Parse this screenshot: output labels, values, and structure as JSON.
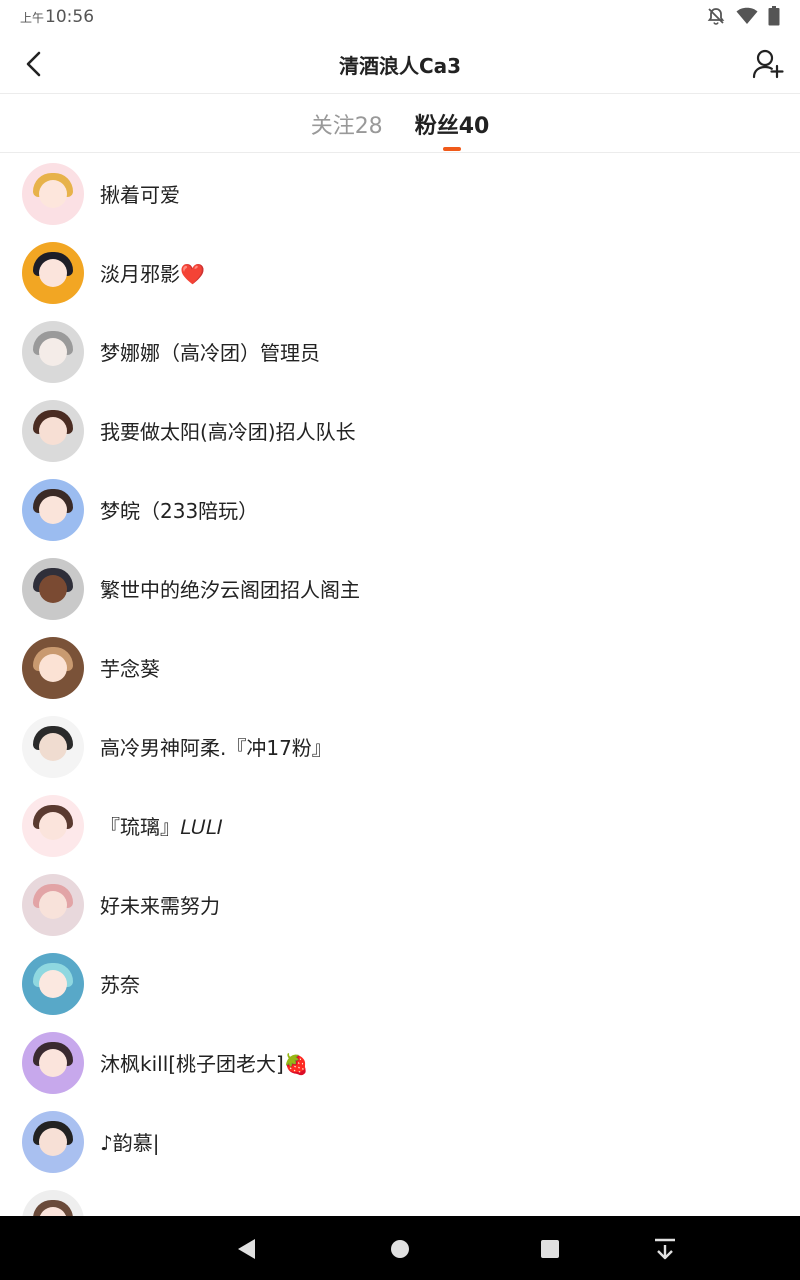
{
  "status_bar": {
    "ampm": "上午",
    "time": "10:56",
    "icons": [
      "bell-off-icon",
      "wifi-icon",
      "battery-icon"
    ]
  },
  "header": {
    "title": "清酒浪人Ca3",
    "back_icon": "back-arrow-icon",
    "add_user_icon": "add-user-icon"
  },
  "tabs": [
    {
      "label": "关注28",
      "active": false
    },
    {
      "label": "粉丝40",
      "active": true
    }
  ],
  "accent_color": "#f05a1a",
  "followers": [
    {
      "name": "揪着可爱",
      "avatar_bg": "#fbe0e4",
      "hair": "#e7b24a",
      "face": "#fde6dc"
    },
    {
      "name": "淡月邪影❤️",
      "avatar_bg": "#f2a623",
      "hair": "#1e1e28",
      "face": "#fbe4dc"
    },
    {
      "name": "梦娜娜（高冷团）管理员",
      "avatar_bg": "#d9d9d9",
      "hair": "#9a9a9a",
      "face": "#f4ece8"
    },
    {
      "name": "我要做太阳(高冷团)招人队长",
      "avatar_bg": "#dadada",
      "hair": "#4a2c22",
      "face": "#f7dfd4"
    },
    {
      "name": "梦皖（233陪玩）",
      "avatar_bg": "#9bbcf0",
      "hair": "#3a2a26",
      "face": "#fae4da"
    },
    {
      "name": "繁世中的绝汐云阁团招人阁主",
      "avatar_bg": "#c9c9c9",
      "hair": "#2f2f3a",
      "face": "#7a4a32"
    },
    {
      "name": "芋念葵",
      "avatar_bg": "#7a5238",
      "hair": "#c99a70",
      "face": "#fbe2d4"
    },
    {
      "name": "高冷男神阿柔.『冲17粉』",
      "avatar_bg": "#f4f4f4",
      "hair": "#2a2a2a",
      "face": "#f0dcd0"
    },
    {
      "name": "『琉璃』𝐿𝑈𝐿𝐼",
      "avatar_bg": "#fde8ea",
      "hair": "#5a3a30",
      "face": "#fbe4dc"
    },
    {
      "name": "好未来需努力",
      "avatar_bg": "#e8d8dc",
      "hair": "#e2a4a6",
      "face": "#f8e2da"
    },
    {
      "name": "苏奈",
      "avatar_bg": "#58a8c8",
      "hair": "#8fd8e0",
      "face": "#fbe8e0"
    },
    {
      "name": "沐枫kill[桃子团老大]🍓",
      "avatar_bg": "#c7a8ec",
      "hair": "#3a2a30",
      "face": "#fbe4dc"
    },
    {
      "name": "♪韵慕|",
      "avatar_bg": "#a9c0f0",
      "hair": "#222222",
      "face": "#f7e0d6"
    },
    {
      "name": "",
      "avatar_bg": "#eeeeee",
      "hair": "#6a4a3a",
      "face": "#fbe4dc"
    }
  ],
  "nav_bar": {
    "icons": [
      "nav-back-icon",
      "nav-home-icon",
      "nav-recents-icon",
      "nav-notification-icon"
    ]
  }
}
